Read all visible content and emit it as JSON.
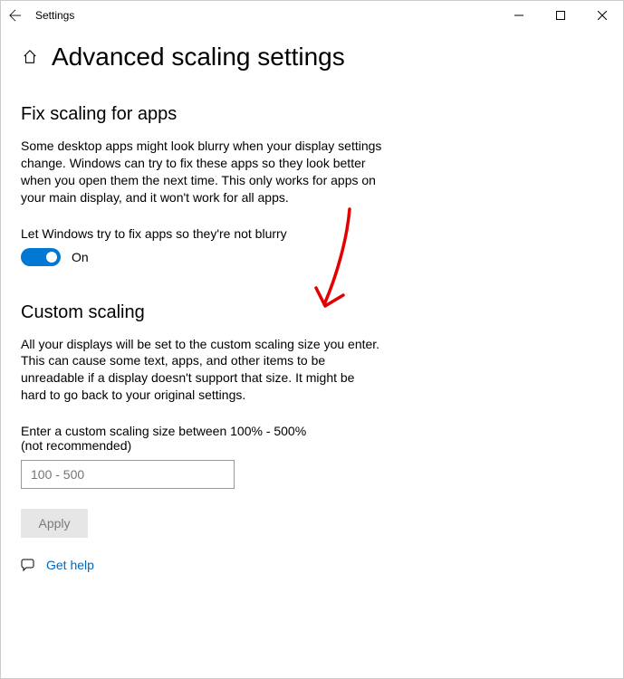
{
  "window": {
    "title": "Settings"
  },
  "page": {
    "title": "Advanced scaling settings"
  },
  "section1": {
    "heading": "Fix scaling for apps",
    "description": "Some desktop apps might look blurry when your display settings change. Windows can try to fix these apps so they look better when you open them the next time. This only works for apps on your main display, and it won't work for all apps.",
    "toggle_label": "Let Windows try to fix apps so they're not blurry",
    "toggle_state": "On"
  },
  "section2": {
    "heading": "Custom scaling",
    "description": "All your displays will be set to the custom scaling size you enter. This can cause some text, apps, and other items to be unreadable if a display doesn't support that size. It might be hard to go back to your original settings.",
    "input_label": "Enter a custom scaling size between 100% - 500% (not recommended)",
    "input_placeholder": "100 - 500",
    "apply_label": "Apply"
  },
  "help": {
    "link_text": "Get help"
  }
}
